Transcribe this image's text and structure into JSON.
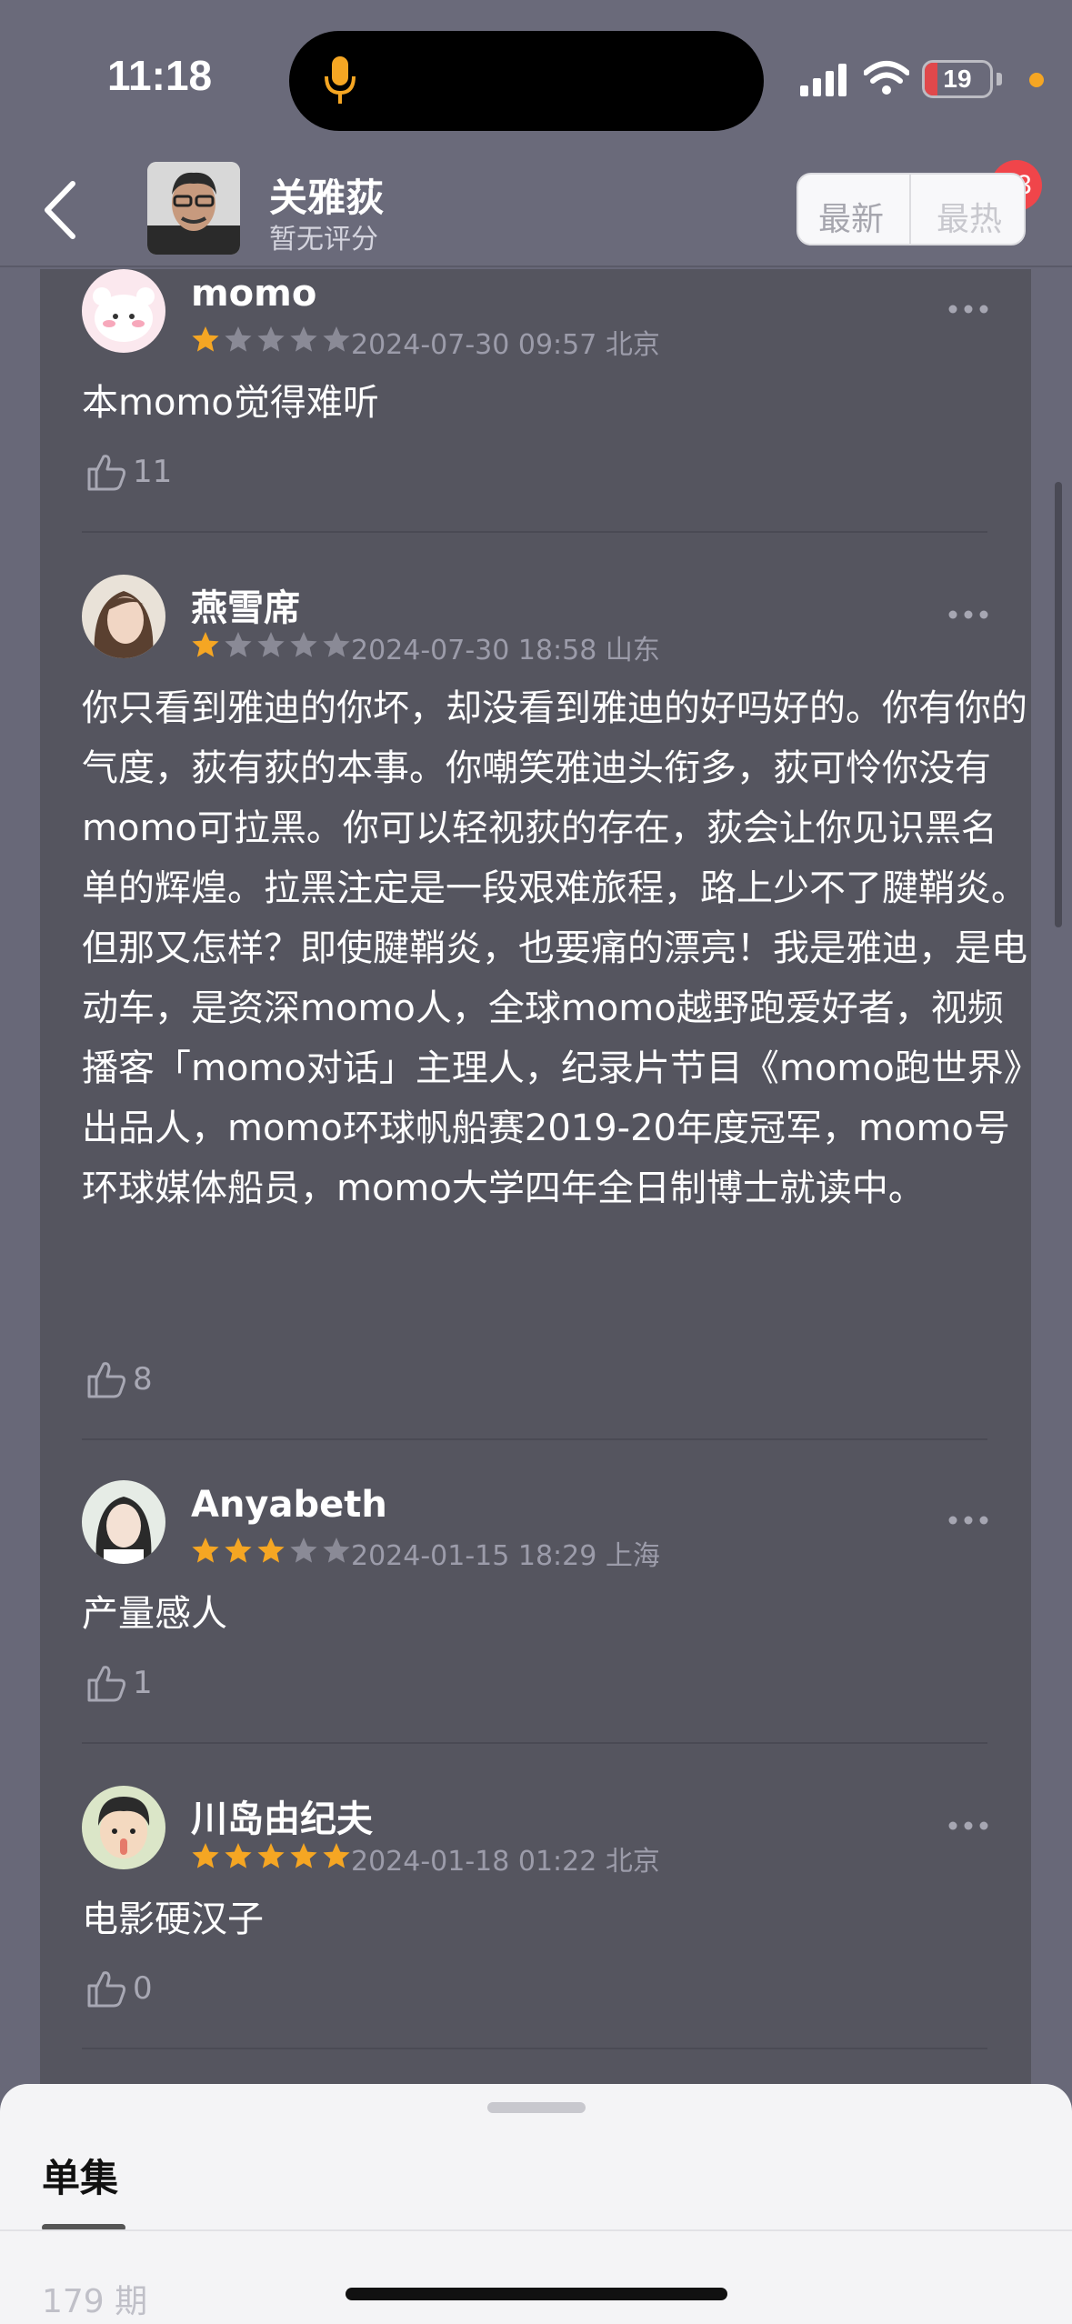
{
  "status_bar": {
    "time": "11:18",
    "battery": "19",
    "battery_level": 0.19
  },
  "header": {
    "name": "关雅荻",
    "subtitle": "暂无评分",
    "badge_count": "13"
  },
  "comments": [
    {
      "user": "momo",
      "rating": 1,
      "time": "2024-07-30 09:57 北京",
      "text": "本momo觉得难听",
      "likes": "11"
    },
    {
      "user": "燕雪席",
      "rating": 1,
      "time": "2024-07-30 18:58 山东",
      "text": "你只看到雅迪的你坏，却没看到雅迪的好吗好的。你有你的气度，荻有荻的本事。你嘲笑雅迪头衔多，荻可怜你没有momo可拉黑。你可以轻视荻的存在，荻会让你见识黑名单的辉煌。拉黑注定是一段艰难旅程，路上少不了腱鞘炎。但那又怎样？即使腱鞘炎，也要痛的漂亮！我是雅迪，是电动车，是资深momo人，全球momo越野跑爱好者，视频播客「momo对话」主理人，纪录片节目《momo跑世界》出品人，momo环球帆船赛2019-20年度冠军，momo号环球媒体船员，momo大学四年全日制博士就读中。",
      "likes": "8"
    },
    {
      "user": "Anyabeth",
      "rating": 3,
      "time": "2024-01-15 18:29 上海",
      "text": "产量感人",
      "likes": "1"
    },
    {
      "user": "川岛由纪夫",
      "rating": 5,
      "time": "2024-01-18 01:22 北京",
      "text": "电影硬汉子",
      "likes": "0"
    }
  ],
  "sheet": {
    "tab": "单集",
    "episode_count": "179 期",
    "sort_newest": "最新",
    "sort_hottest": "最热"
  },
  "colors": {
    "star_on": "#f5a623",
    "star_off": "#8a8a96",
    "background": "#686878",
    "panel": "#55555f"
  },
  "icons": [
    "mic-icon",
    "signal-icon",
    "wifi-icon",
    "back-icon",
    "more-icon",
    "star-icon",
    "thumbs-up-icon"
  ]
}
